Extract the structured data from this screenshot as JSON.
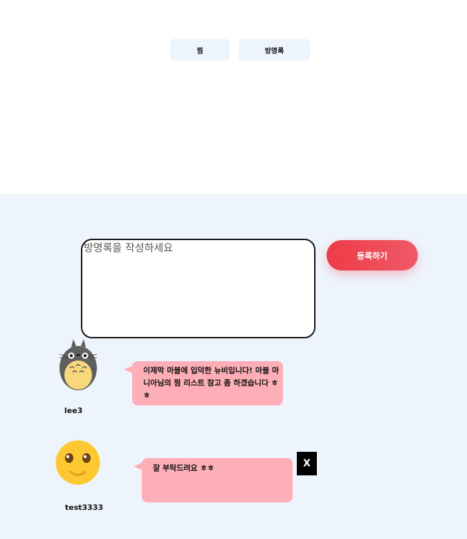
{
  "tabs": [
    {
      "label": "찜"
    },
    {
      "label": "방명록"
    }
  ],
  "guestbook": {
    "placeholder": "방명록을 작성하세요",
    "submit_label": "등록하기"
  },
  "entries": [
    {
      "username": "lee3",
      "message": "이제막 마블에 입덕한 뉴비입니다! 마블 마니아님의 찜 리스트 참고 좀 하겠습니다 ㅎㅎ",
      "avatar": "totoro-avatar"
    },
    {
      "username": "test3333",
      "message": "잘 부탁드려요 ㅎㅎ",
      "avatar": "smiley-avatar",
      "delete_label": "X"
    }
  ],
  "colors": {
    "accent": "#ee3b48",
    "section_bg": "#eef4fc",
    "bubble": "#fdaeb6",
    "tab_bg": "#edf4fd"
  }
}
